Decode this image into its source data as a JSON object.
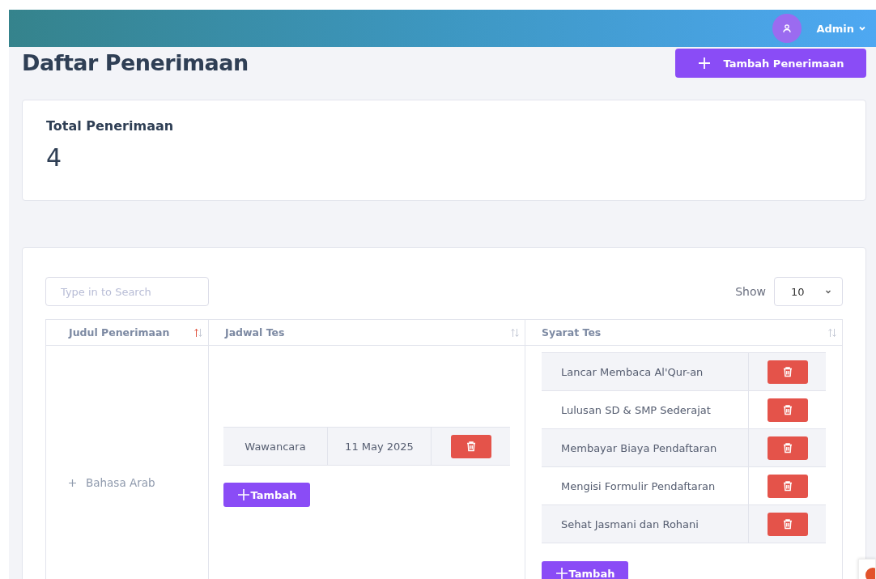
{
  "header": {
    "user": "Admin"
  },
  "page": {
    "title": "Daftar Penerimaan",
    "add_button": "Tambah Penerimaan"
  },
  "summary": {
    "label": "Total Penerimaan",
    "value": "4"
  },
  "table": {
    "search": {
      "placeholder": "Type in to Search"
    },
    "show_label": "Show",
    "page_size": "10",
    "columns": [
      {
        "label": "Judul Penerimaan",
        "sorted": true
      },
      {
        "label": "Jadwal Tes",
        "sorted": false
      },
      {
        "label": "Syarat Tes",
        "sorted": false
      }
    ],
    "rows": [
      {
        "title": "Bahasa Arab",
        "expanded": false,
        "schedule": [
          {
            "name": "Wawancara",
            "date": "11 May 2025"
          }
        ],
        "requirements": [
          "Lancar Membaca Al'Qur-an",
          "Lulusan SD & SMP Sederajat",
          "Membayar Biaya Pendaftaran",
          "Mengisi Formulir Pendaftaran",
          "Sehat Jasmani dan Rohani"
        ],
        "schedule_add_label": "Tambah",
        "requirements_add_label": "Tambah"
      }
    ]
  }
}
